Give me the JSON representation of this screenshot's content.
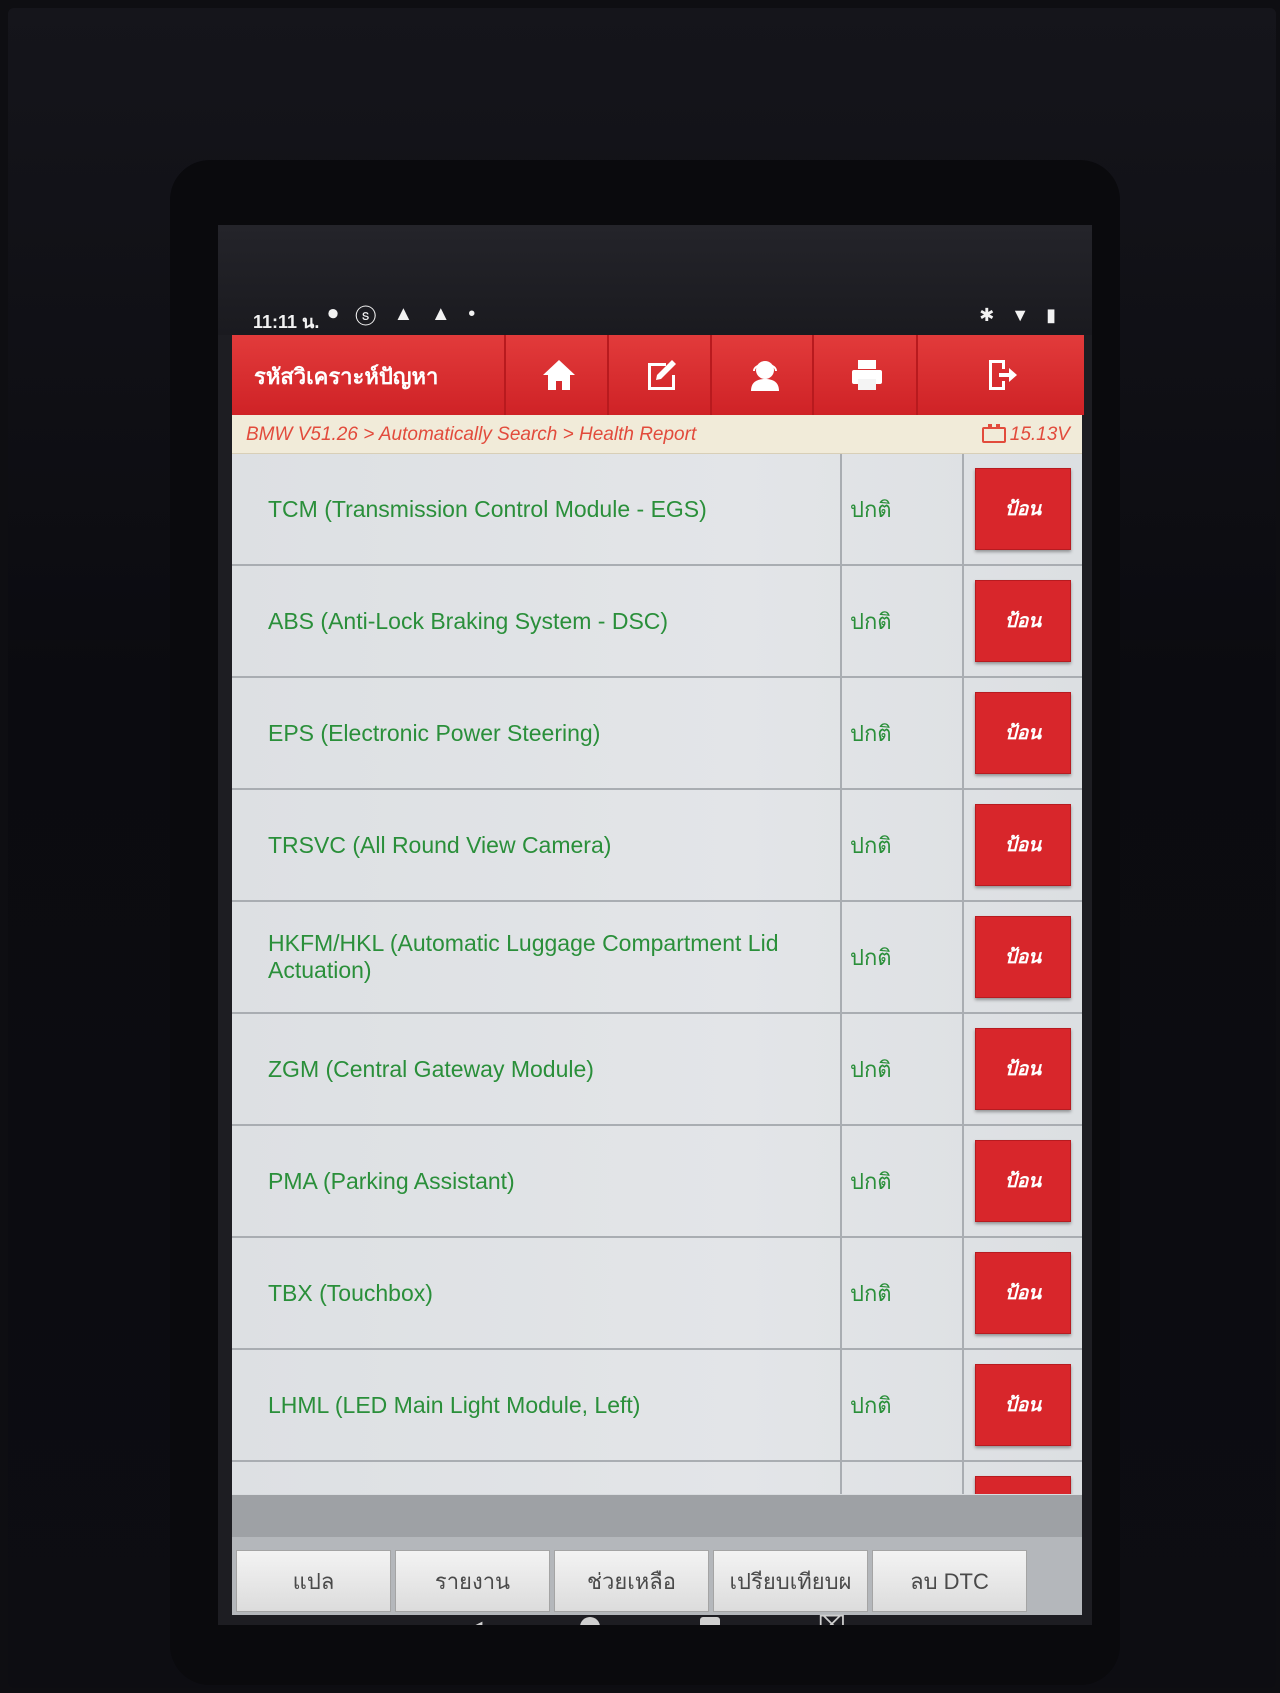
{
  "status_bar": {
    "time": "11:11 น.",
    "left_icons": "⏺ ⓢ ▲ ▲ •",
    "right_icons": "✱ ▼ ▮"
  },
  "app": {
    "title": "รหัสวิเคราะห์ปัญหา",
    "toolbar": {
      "home_icon": "home-icon",
      "edit_icon": "edit-icon",
      "support_icon": "support-icon",
      "print_icon": "print-icon",
      "exit_icon": "exit-icon"
    },
    "breadcrumb": "BMW V51.26 > Automatically Search > Health Report",
    "voltage": "15.13V"
  },
  "modules": [
    {
      "name": "TCM (Transmission Control Module - EGS)",
      "status": "ปกติ",
      "action": "ป้อน"
    },
    {
      "name": "ABS (Anti-Lock Braking System - DSC)",
      "status": "ปกติ",
      "action": "ป้อน"
    },
    {
      "name": "EPS (Electronic Power Steering)",
      "status": "ปกติ",
      "action": "ป้อน"
    },
    {
      "name": "TRSVC (All Round View Camera)",
      "status": "ปกติ",
      "action": "ป้อน"
    },
    {
      "name": "HKFM/HKL (Automatic Luggage Compartment Lid Actuation)",
      "status": "ปกติ",
      "action": "ป้อน"
    },
    {
      "name": "ZGM (Central Gateway Module)",
      "status": "ปกติ",
      "action": "ป้อน"
    },
    {
      "name": "PMA (Parking Assistant)",
      "status": "ปกติ",
      "action": "ป้อน"
    },
    {
      "name": "TBX (Touchbox)",
      "status": "ปกติ",
      "action": "ป้อน"
    },
    {
      "name": "LHML (LED Main Light Module, Left)",
      "status": "ปกติ",
      "action": "ป้อน"
    }
  ],
  "bottom_buttons": [
    "แปล",
    "รายงาน",
    "ช่วยเหลือ",
    "เปรียบเทียบผ",
    "ลบ DTC"
  ],
  "colors": {
    "accent_red": "#d8262b",
    "module_text_green": "#2a8f3a",
    "breadcrumb_red": "#e24b3c"
  }
}
